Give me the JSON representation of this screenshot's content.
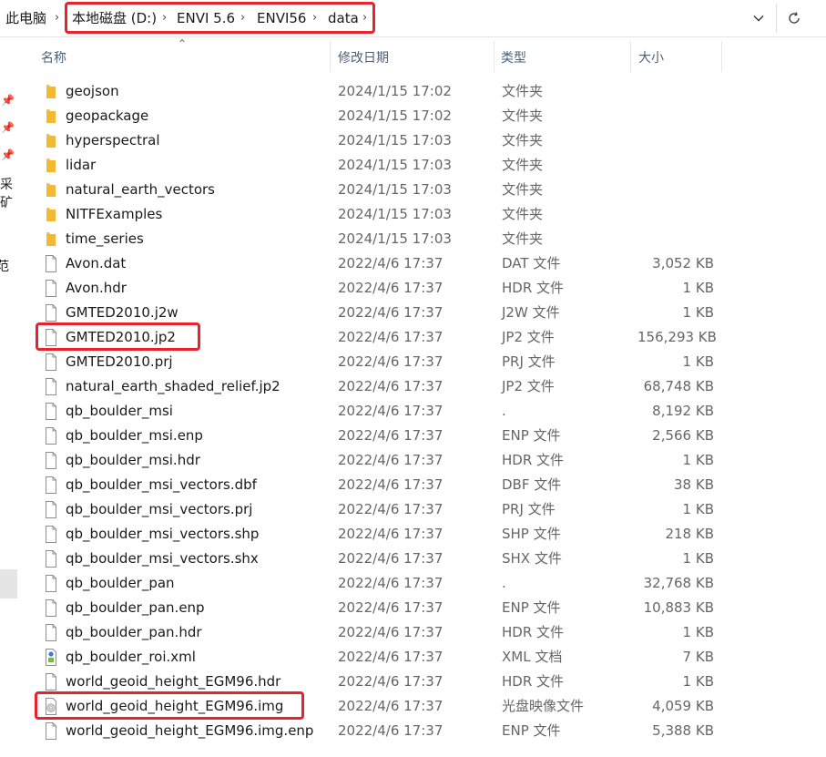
{
  "address_bar": {
    "root": "此电脑",
    "crumbs": [
      "本地磁盘 (D:)",
      "ENVI 5.6",
      "ENVI56",
      "data"
    ]
  },
  "nav_pane": {
    "partial_items": [
      "采矿",
      "范"
    ]
  },
  "columns": {
    "name": "名称",
    "date": "修改日期",
    "type": "类型",
    "size": "大小"
  },
  "files": [
    {
      "name": "geojson",
      "date": "2024/1/15 17:02",
      "type": "文件夹",
      "size": "",
      "icon": "folder-icon"
    },
    {
      "name": "geopackage",
      "date": "2024/1/15 17:02",
      "type": "文件夹",
      "size": "",
      "icon": "folder-icon"
    },
    {
      "name": "hyperspectral",
      "date": "2024/1/15 17:03",
      "type": "文件夹",
      "size": "",
      "icon": "folder-icon"
    },
    {
      "name": "lidar",
      "date": "2024/1/15 17:03",
      "type": "文件夹",
      "size": "",
      "icon": "folder-icon"
    },
    {
      "name": "natural_earth_vectors",
      "date": "2024/1/15 17:03",
      "type": "文件夹",
      "size": "",
      "icon": "folder-icon"
    },
    {
      "name": "NITFExamples",
      "date": "2024/1/15 17:03",
      "type": "文件夹",
      "size": "",
      "icon": "folder-icon"
    },
    {
      "name": "time_series",
      "date": "2024/1/15 17:03",
      "type": "文件夹",
      "size": "",
      "icon": "folder-icon"
    },
    {
      "name": "Avon.dat",
      "date": "2022/4/6 17:37",
      "type": "DAT 文件",
      "size": "3,052 KB",
      "icon": "file-icon"
    },
    {
      "name": "Avon.hdr",
      "date": "2022/4/6 17:37",
      "type": "HDR 文件",
      "size": "1 KB",
      "icon": "file-icon"
    },
    {
      "name": "GMTED2010.j2w",
      "date": "2022/4/6 17:37",
      "type": "J2W 文件",
      "size": "1 KB",
      "icon": "file-icon"
    },
    {
      "name": "GMTED2010.jp2",
      "date": "2022/4/6 17:37",
      "type": "JP2 文件",
      "size": "156,293 KB",
      "icon": "file-icon"
    },
    {
      "name": "GMTED2010.prj",
      "date": "2022/4/6 17:37",
      "type": "PRJ 文件",
      "size": "1 KB",
      "icon": "file-icon"
    },
    {
      "name": "natural_earth_shaded_relief.jp2",
      "date": "2022/4/6 17:37",
      "type": "JP2 文件",
      "size": "68,748 KB",
      "icon": "file-icon"
    },
    {
      "name": "qb_boulder_msi",
      "date": "2022/4/6 17:37",
      "type": ".",
      "size": "8,192 KB",
      "icon": "file-icon"
    },
    {
      "name": "qb_boulder_msi.enp",
      "date": "2022/4/6 17:37",
      "type": "ENP 文件",
      "size": "2,566 KB",
      "icon": "file-icon"
    },
    {
      "name": "qb_boulder_msi.hdr",
      "date": "2022/4/6 17:37",
      "type": "HDR 文件",
      "size": "1 KB",
      "icon": "file-icon"
    },
    {
      "name": "qb_boulder_msi_vectors.dbf",
      "date": "2022/4/6 17:37",
      "type": "DBF 文件",
      "size": "38 KB",
      "icon": "file-icon"
    },
    {
      "name": "qb_boulder_msi_vectors.prj",
      "date": "2022/4/6 17:37",
      "type": "PRJ 文件",
      "size": "1 KB",
      "icon": "file-icon"
    },
    {
      "name": "qb_boulder_msi_vectors.shp",
      "date": "2022/4/6 17:37",
      "type": "SHP 文件",
      "size": "218 KB",
      "icon": "file-icon"
    },
    {
      "name": "qb_boulder_msi_vectors.shx",
      "date": "2022/4/6 17:37",
      "type": "SHX 文件",
      "size": "1 KB",
      "icon": "file-icon"
    },
    {
      "name": "qb_boulder_pan",
      "date": "2022/4/6 17:37",
      "type": ".",
      "size": "32,768 KB",
      "icon": "file-icon"
    },
    {
      "name": "qb_boulder_pan.enp",
      "date": "2022/4/6 17:37",
      "type": "ENP 文件",
      "size": "10,883 KB",
      "icon": "file-icon"
    },
    {
      "name": "qb_boulder_pan.hdr",
      "date": "2022/4/6 17:37",
      "type": "HDR 文件",
      "size": "1 KB",
      "icon": "file-icon"
    },
    {
      "name": "qb_boulder_roi.xml",
      "date": "2022/4/6 17:37",
      "type": "XML 文档",
      "size": "7 KB",
      "icon": "xml-file-icon"
    },
    {
      "name": "world_geoid_height_EGM96.hdr",
      "date": "2022/4/6 17:37",
      "type": "HDR 文件",
      "size": "1 KB",
      "icon": "file-icon"
    },
    {
      "name": "world_geoid_height_EGM96.img",
      "date": "2022/4/6 17:37",
      "type": "光盘映像文件",
      "size": "4,059 KB",
      "icon": "disc-image-icon"
    },
    {
      "name": "world_geoid_height_EGM96.img.enp",
      "date": "2022/4/6 17:37",
      "type": "ENP 文件",
      "size": "5,388 KB",
      "icon": "file-icon"
    }
  ],
  "colors": {
    "highlight": "#e8232c",
    "folder": "#f8c444",
    "header_text": "#4c607a"
  }
}
